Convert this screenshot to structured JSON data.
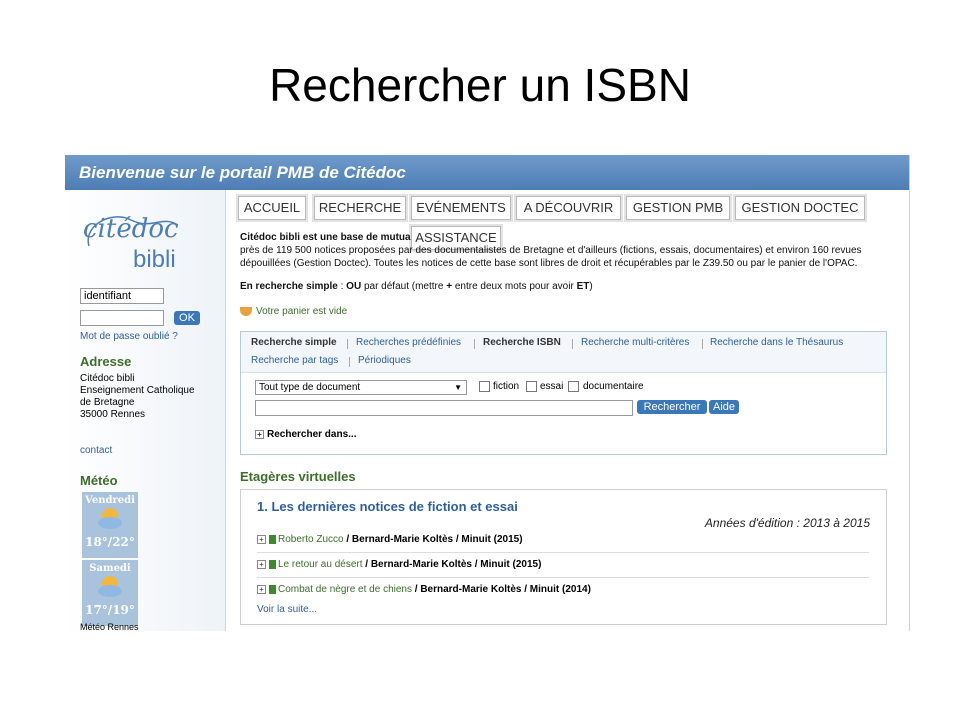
{
  "slide": {
    "title": "Rechercher un ISBN"
  },
  "banner": {
    "text": "Bienvenue sur le portail PMB de Citédoc"
  },
  "sidebar": {
    "logo_script": "citédoc",
    "logo_name": "bibli",
    "login_value": "identifiant",
    "ok_label": "OK",
    "forgot_password": "Mot de passe oublié ?",
    "address_heading": "Adresse",
    "address_lines": [
      "Citédoc bibli",
      "Enseignement Catholique",
      "de Bretagne",
      "35000 Rennes"
    ],
    "contact": "contact",
    "meteo_heading": "Météo",
    "forecast": [
      {
        "day": "Vendredi",
        "temp": "18°/22°"
      },
      {
        "day": "Samedi",
        "temp": "17°/19°"
      }
    ],
    "meteo_city": "Météo Rennes"
  },
  "tabs": [
    "ACCUEIL",
    "RECHERCHE",
    "EVÉNEMENTS",
    "A DÉCOUVRIR",
    "GESTION PMB",
    "GESTION DOCTEC",
    "ASSISTANCE"
  ],
  "intro": {
    "bold_start": "Citédoc bibli est une base de mutua",
    "line2": "près de 119 500 notices proposées par des documentalistes de Bretagne et d'ailleurs (fictions, essais, documentaires) et  environ 160 revues",
    "line3": "dépouillées (Gestion Doctec). Toutes les notices de cette base sont libres de droit et récupérables par le Z39.50 ou par le panier de l'OPAC.",
    "search_hint_a": "En recherche simple",
    "search_hint_b": " : ",
    "search_hint_ou": "OU",
    "search_hint_c": " par défaut (mettre ",
    "search_hint_plus": "+",
    "search_hint_d": " entre deux mots pour avoir ",
    "search_hint_et": "ET",
    "search_hint_e": ")"
  },
  "panier": "Votre panier est vide",
  "search": {
    "tabs": [
      "Recherche simple",
      "Recherches prédéfinies",
      "Recherche ISBN",
      "Recherche multi-critères",
      "Recherche dans le Thésaurus",
      "Recherche par tags",
      "Périodiques"
    ],
    "doc_type": "Tout type de document",
    "filters": [
      "fiction",
      "essai",
      "documentaire"
    ],
    "search_button": "Rechercher",
    "help_button": "Aide",
    "search_in": "Rechercher dans..."
  },
  "shelves": {
    "heading": "Etagères virtuelles",
    "title": "1. Les dernières notices de fiction et essai",
    "years": "Années d'édition : 2013 à 2015",
    "notices": [
      {
        "title": "Roberto Zucco",
        "rest": " / Bernard-Marie Koltès / Minuit (2015)"
      },
      {
        "title": "Le retour au désert",
        "rest": " / Bernard-Marie Koltès / Minuit (2015)"
      },
      {
        "title": "Combat de nègre et de chiens",
        "rest": " / Bernard-Marie Koltès / Minuit (2014)"
      }
    ],
    "more": "Voir la suite..."
  }
}
